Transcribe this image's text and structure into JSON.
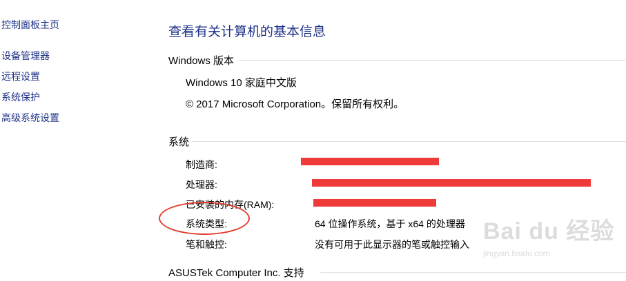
{
  "sidebar": {
    "home": "控制面板主页",
    "items": [
      "设备管理器",
      "远程设置",
      "系统保护",
      "高级系统设置"
    ]
  },
  "main": {
    "title": "查看有关计算机的基本信息",
    "windows_section": {
      "title": "Windows 版本",
      "edition": "Windows 10 家庭中文版",
      "copyright": "© 2017 Microsoft Corporation。保留所有权利。"
    },
    "system_section": {
      "title": "系统",
      "rows": [
        {
          "label": "制造商:",
          "value": ""
        },
        {
          "label": "处理器:",
          "value": ""
        },
        {
          "label": "已安装的内存(RAM):",
          "value": ""
        },
        {
          "label": "系统类型:",
          "value": "64 位操作系统，基于 x64 的处理器"
        },
        {
          "label": "笔和触控:",
          "value": "没有可用于此显示器的笔或触控输入"
        }
      ]
    },
    "support_section": {
      "title": "ASUSTek Computer Inc. 支持"
    }
  },
  "colors": {
    "link": "#1e3287",
    "redaction": "#f03a3a",
    "annotation_circle": "#e23b2b"
  },
  "watermark": {
    "main": "Bai du 经验",
    "sub": "jingyan.baidu.com"
  }
}
